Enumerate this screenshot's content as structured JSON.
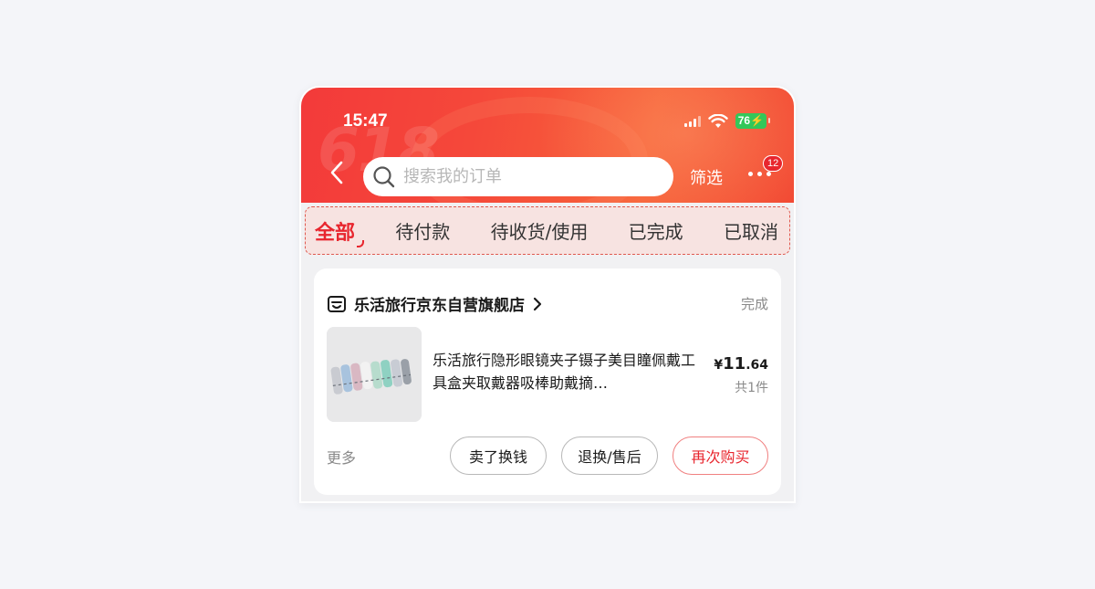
{
  "status_bar": {
    "time": "15:47",
    "battery": "76",
    "icons": [
      "signal-icon",
      "wifi-icon",
      "battery-icon"
    ]
  },
  "header": {
    "watermark": "618",
    "search_placeholder": "搜索我的订单",
    "filter_label": "筛选",
    "more_badge": "12",
    "icons": [
      "back-icon",
      "search-icon",
      "more-icon"
    ]
  },
  "tabs": [
    {
      "label": "全部",
      "active": true
    },
    {
      "label": "待付款",
      "active": false
    },
    {
      "label": "待收货/使用",
      "active": false
    },
    {
      "label": "已完成",
      "active": false
    },
    {
      "label": "已取消",
      "active": false
    }
  ],
  "order": {
    "shop_name": "乐活旅行京东自营旗舰店",
    "status": "完成",
    "product_title": "乐活旅行隐形眼镜夹子镊子美目瞳佩戴工具盒夹取戴器吸棒助戴摘…",
    "price_symbol": "¥",
    "price_int": "11",
    "price_dec": ".64",
    "quantity": "共1件",
    "more_label": "更多",
    "actions": [
      "卖了换钱",
      "退换/售后",
      "再次购买"
    ]
  },
  "colors": {
    "accent": "#e8262e",
    "header_red": "#f33a3a",
    "battery_green": "#34c759"
  }
}
